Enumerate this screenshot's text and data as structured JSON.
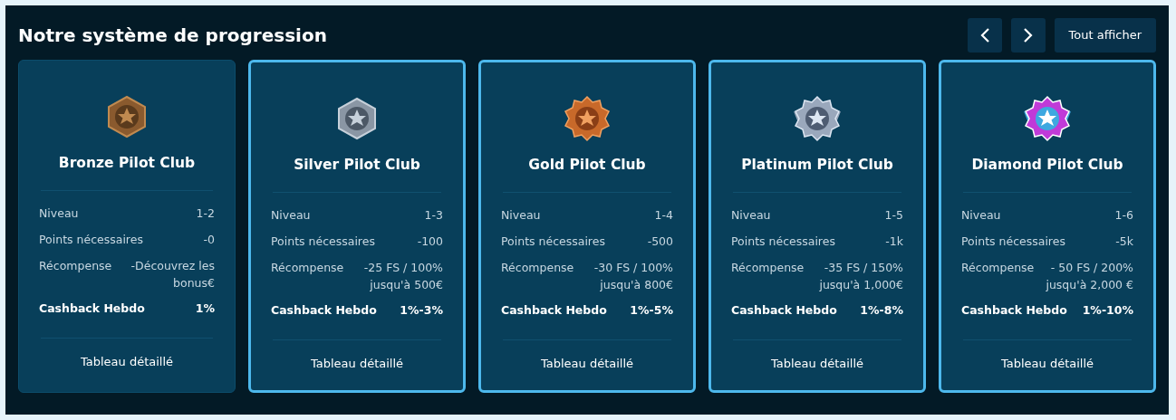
{
  "title": "Notre système de progression",
  "nav": {
    "view_all": "Tout afficher"
  },
  "tiers": [
    {
      "kind": "bronze",
      "highlighted": false,
      "name": "Bronze Pilot Club",
      "rows": [
        {
          "kind": "plain",
          "label": "Niveau",
          "value": "1-2"
        },
        {
          "kind": "plain",
          "label": "Points nécessaires",
          "value": "-0"
        },
        {
          "kind": "plain",
          "label": "Récompense",
          "value": "-Découvrez les bonus€"
        },
        {
          "kind": "strong",
          "label": "Cashback Hebdo",
          "value": "1%"
        }
      ],
      "link": "Tableau détaillé"
    },
    {
      "kind": "silver",
      "highlighted": true,
      "name": "Silver Pilot Club",
      "rows": [
        {
          "kind": "plain",
          "label": "Niveau",
          "value": "1-3"
        },
        {
          "kind": "plain",
          "label": "Points nécessaires",
          "value": "-100"
        },
        {
          "kind": "plain",
          "label": "Récompense",
          "value": "-25 FS / 100% jusqu'à 500€"
        },
        {
          "kind": "strong",
          "label": "Cashback Hebdo",
          "value": "1%-3%"
        }
      ],
      "link": "Tableau détaillé"
    },
    {
      "kind": "gold",
      "highlighted": true,
      "name": "Gold Pilot Club",
      "rows": [
        {
          "kind": "plain",
          "label": "Niveau",
          "value": "1-4"
        },
        {
          "kind": "plain",
          "label": "Points nécessaires",
          "value": "-500"
        },
        {
          "kind": "plain",
          "label": "Récompense",
          "value": "-30 FS / 100% jusqu'à 800€"
        },
        {
          "kind": "strong",
          "label": "Cashback Hebdo",
          "value": "1%-5%"
        }
      ],
      "link": "Tableau détaillé"
    },
    {
      "kind": "platinum",
      "highlighted": true,
      "name": "Platinum Pilot Club",
      "rows": [
        {
          "kind": "plain",
          "label": "Niveau",
          "value": "1-5"
        },
        {
          "kind": "plain",
          "label": "Points nécessaires",
          "value": "-1k"
        },
        {
          "kind": "plain",
          "label": "Récompense",
          "value": "-35 FS / 150% jusqu'à 1,000€"
        },
        {
          "kind": "strong",
          "label": "Cashback Hebdo",
          "value": "1%-8%"
        }
      ],
      "link": "Tableau détaillé"
    },
    {
      "kind": "diamond",
      "highlighted": true,
      "name": "Diamond Pilot Club",
      "rows": [
        {
          "kind": "plain",
          "label": "Niveau",
          "value": "1-6"
        },
        {
          "kind": "plain",
          "label": "Points nécessaires",
          "value": "-5k"
        },
        {
          "kind": "plain",
          "label": "Récompense",
          "value": "- 50 FS / 200% jusqu'à 2,000 €"
        },
        {
          "kind": "strong",
          "label": "Cashback Hebdo",
          "value": "1%-10%"
        }
      ],
      "link": "Tableau détaillé"
    }
  ]
}
